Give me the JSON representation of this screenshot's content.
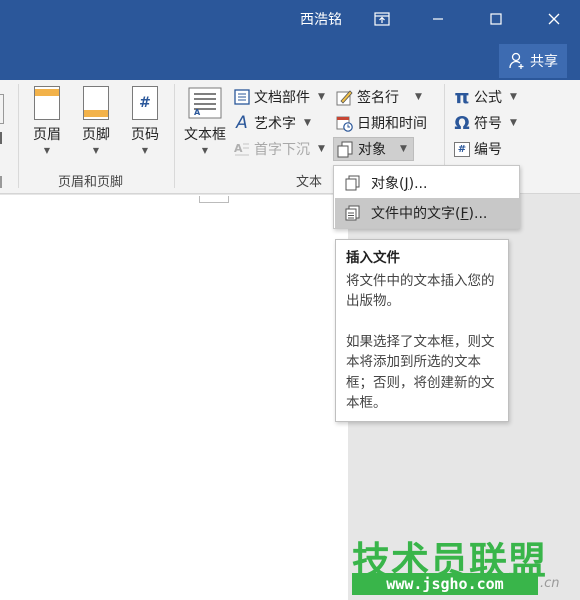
{
  "titlebar": {
    "user": "西浩铭",
    "share_label": "共享",
    "bg_color": "#2b579a"
  },
  "ribbon": {
    "header_footer": {
      "header_label": "页眉",
      "footer_label": "页脚",
      "page_number_label": "页码",
      "group_label": "页眉和页脚"
    },
    "text": {
      "textbox_label": "文本框",
      "quick_parts_label": "文档部件",
      "wordart_label": "艺术字",
      "dropcap_label": "首字下沉",
      "signature_label": "签名行",
      "datetime_label": "日期和时间",
      "object_label": "对象",
      "group_label": "文本"
    },
    "symbols": {
      "equation_label": "公式",
      "symbol_label": "符号",
      "numbering_label": "编号",
      "pi_glyph": "π",
      "omega_glyph": "Ω",
      "hash_glyph": "#"
    }
  },
  "menu": {
    "item1_pre": "对象(",
    "item1_key": "J",
    "item1_post": ")...",
    "item2_pre": "文件中的文字(",
    "item2_key": "F",
    "item2_post": ")..."
  },
  "tooltip": {
    "title": "插入文件",
    "p1": "将文件中的文本插入您的出版物。",
    "p2": "如果选择了文本框，则文本将添加到所选的文本框；否则，将创建新的文本框。"
  },
  "watermark": {
    "title": "技术员联盟",
    "url": "www.jsgho.com",
    "suffix": ".cn",
    "color": "#39b54a"
  }
}
